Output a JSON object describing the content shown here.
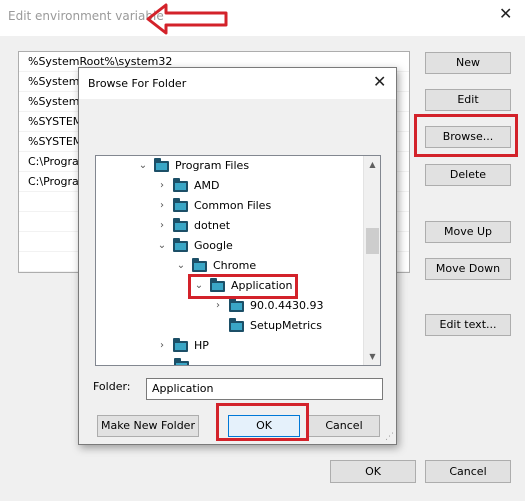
{
  "window": {
    "title": "Edit environment variable",
    "close_glyph": "✕"
  },
  "paths": [
    "%SystemRoot%\\system32",
    "%SystemR",
    "%SystemR",
    "%SYSTEM",
    "%SYSTEM",
    "C:\\Progra",
    "C:\\Progra"
  ],
  "side_buttons": {
    "new": "New",
    "edit": "Edit",
    "browse": "Browse...",
    "delete": "Delete",
    "move_up": "Move Up",
    "move_down": "Move Down",
    "edit_text": "Edit text..."
  },
  "footer": {
    "ok": "OK",
    "cancel": "Cancel"
  },
  "browse_dialog": {
    "title": "Browse For Folder",
    "close_glyph": "✕",
    "tree": [
      {
        "label": "Program Files",
        "arrow": "⌄"
      },
      {
        "label": "AMD",
        "arrow": "›"
      },
      {
        "label": "Common Files",
        "arrow": "›"
      },
      {
        "label": "dotnet",
        "arrow": "›"
      },
      {
        "label": "Google",
        "arrow": "⌄"
      },
      {
        "label": "Chrome",
        "arrow": "⌄"
      },
      {
        "label": "Application",
        "arrow": "⌄",
        "selected": true
      },
      {
        "label": "90.0.4430.93",
        "arrow": "›"
      },
      {
        "label": "SetupMetrics",
        "arrow": ""
      },
      {
        "label": "HP",
        "arrow": "›"
      }
    ],
    "folder_label": "Folder:",
    "folder_value": "Application",
    "make_new_folder": "Make New Folder",
    "ok": "OK",
    "cancel": "Cancel"
  },
  "annotation_color": "#d3222a",
  "icons": [
    "red-arrow-icon",
    "folder-icon",
    "close-icon",
    "chevron-icon"
  ]
}
